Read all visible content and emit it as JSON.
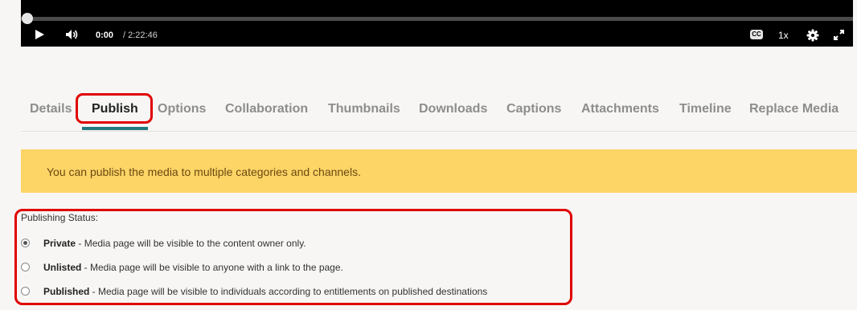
{
  "player": {
    "current_time": "0:00",
    "total_time": "/ 2:22:46",
    "playback_speed": "1x",
    "cc_label": "CC",
    "progress_fraction": 0.0
  },
  "tabs": [
    {
      "label": "Details",
      "active": false
    },
    {
      "label": "Publish",
      "active": true
    },
    {
      "label": "Options",
      "active": false
    },
    {
      "label": "Collaboration",
      "active": false
    },
    {
      "label": "Thumbnails",
      "active": false
    },
    {
      "label": "Downloads",
      "active": false
    },
    {
      "label": "Captions",
      "active": false
    },
    {
      "label": "Attachments",
      "active": false
    },
    {
      "label": "Timeline",
      "active": false
    },
    {
      "label": "Replace Media",
      "active": false
    }
  ],
  "alert": {
    "message": "You can publish the media to multiple categories and channels."
  },
  "publishing": {
    "label": "Publishing Status:",
    "options": [
      {
        "name": "Private",
        "description": " - Media page will be visible to the content owner only.",
        "selected": true
      },
      {
        "name": "Unlisted",
        "description": " - Media page will be visible to anyone with a link to the page.",
        "selected": false
      },
      {
        "name": "Published",
        "description": " - Media page will be visible to individuals according to entitlements on published destinations",
        "selected": false
      }
    ]
  },
  "colors": {
    "accent": "#227a80",
    "alert_background": "#fdd466",
    "highlight": "#e00000"
  }
}
